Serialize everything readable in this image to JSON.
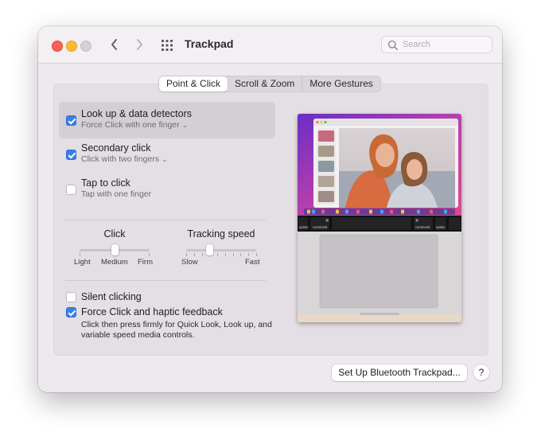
{
  "window": {
    "title": "Trackpad",
    "search_placeholder": "Search"
  },
  "tabs": [
    {
      "label": "Point & Click",
      "active": true
    },
    {
      "label": "Scroll & Zoom",
      "active": false
    },
    {
      "label": "More Gestures",
      "active": false
    }
  ],
  "options": {
    "lookup": {
      "title": "Look up & data detectors",
      "sub": "Force Click with one finger",
      "checked": true
    },
    "secondary": {
      "title": "Secondary click",
      "sub": "Click with two fingers",
      "checked": true
    },
    "tap": {
      "title": "Tap to click",
      "sub": "Tap with one finger",
      "checked": false
    },
    "silent": {
      "title": "Silent clicking",
      "checked": false
    },
    "force": {
      "title": "Force Click and haptic feedback",
      "checked": true,
      "help": "Click then press firmly for Quick Look, Look up, and variable speed media controls."
    }
  },
  "sliders": {
    "click": {
      "title": "Click",
      "min_label": "Light",
      "mid_label": "Medium",
      "max_label": "Firm",
      "value": 0.5
    },
    "tracking": {
      "title": "Tracking speed",
      "min_label": "Slow",
      "max_label": "Fast",
      "value": 0.33
    }
  },
  "keys": {
    "command_left": "command",
    "command_right": "command",
    "option_left": "option",
    "option_right": "option",
    "cmd_symbol": "⌘"
  },
  "buttons": {
    "setup_bluetooth": "Set Up Bluetooth Trackpad...",
    "help": "?"
  },
  "colors": {
    "accent": "#3a7ee8"
  }
}
